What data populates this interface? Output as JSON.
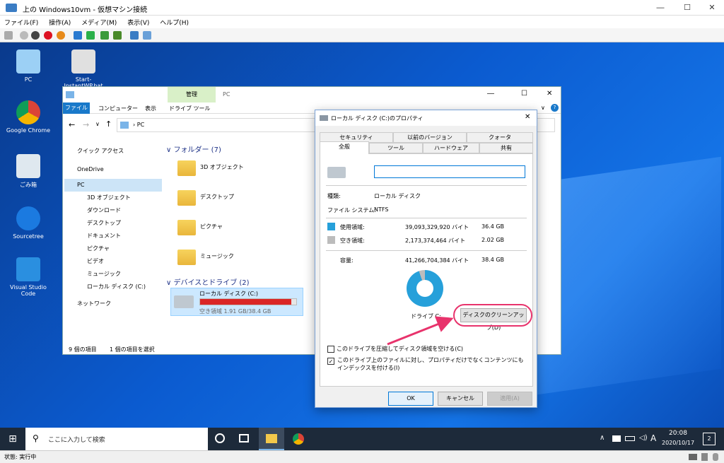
{
  "vm": {
    "title": "上の Windows10vm - 仮想マシン接続",
    "menu": [
      "ファイル(F)",
      "操作(A)",
      "メディア(M)",
      "表示(V)",
      "ヘルプ(H)"
    ],
    "status": "状態: 実行中"
  },
  "desktop": {
    "icons": [
      "PC",
      "Start-InstantWP.bat",
      "Google Chrome",
      "ごみ箱",
      "Sourcetree",
      "Visual Studio Code"
    ]
  },
  "explorer": {
    "ribbon_manage": "管理",
    "ribbon_title": "PC",
    "tabs": [
      "ファイル",
      "コンピューター",
      "表示",
      "ドライブ ツール"
    ],
    "address": "PC",
    "sidebar": [
      "クイック アクセス",
      "OneDrive",
      "PC",
      "3D オブジェクト",
      "ダウンロード",
      "デスクトップ",
      "ドキュメント",
      "ピクチャ",
      "ビデオ",
      "ミュージック",
      "ローカル ディスク (C:)",
      "ネットワーク"
    ],
    "folders_header": "フォルダー (7)",
    "folders": [
      "3D オブジェクト",
      "デスクトップ",
      "ピクチャ",
      "ミュージック"
    ],
    "drives_header": "デバイスとドライブ (2)",
    "drive_name": "ローカル ディスク (C:)",
    "drive_free": "空き領域 1.91 GB/38.4 GB",
    "status_items": "9 個の項目",
    "status_selected": "1 個の項目を選択"
  },
  "props": {
    "title": "ローカル ディスク (C:)のプロパティ",
    "tabs_top": [
      "セキュリティ",
      "以前のバージョン",
      "クォータ"
    ],
    "tabs_bottom": [
      "全般",
      "ツール",
      "ハードウェア",
      "共有"
    ],
    "type_label": "種類:",
    "type_value": "ローカル ディスク",
    "fs_label": "ファイル システム:",
    "fs_value": "NTFS",
    "used_label": "使用領域:",
    "used_bytes": "39,093,329,920 バイト",
    "used_gb": "36.4 GB",
    "free_label": "空き領域:",
    "free_bytes": "2,173,374,464 バイト",
    "free_gb": "2.02 GB",
    "cap_label": "容量:",
    "cap_bytes": "41,266,704,384 バイト",
    "cap_gb": "38.4 GB",
    "drive_label": "ドライブ C:",
    "cleanup": "ディスクのクリーンアップ(D)",
    "compress": "このドライブを圧縮してディスク領域を空ける(C)",
    "index": "このドライブ上のファイルに対し、プロパティだけでなくコンテンツにもインデックスを付ける(I)",
    "ok": "OK",
    "cancel": "キャンセル",
    "apply": "適用(A)",
    "used_fraction": 0.947
  },
  "taskbar": {
    "search": "ここに入力して検索",
    "ime": "A",
    "time": "20:08",
    "date": "2020/10/17",
    "badge": "2"
  },
  "colors": {
    "accent": "#0078d7",
    "used": "#26a0da",
    "free": "#bcbcbc",
    "highlight": "#e8336c"
  }
}
